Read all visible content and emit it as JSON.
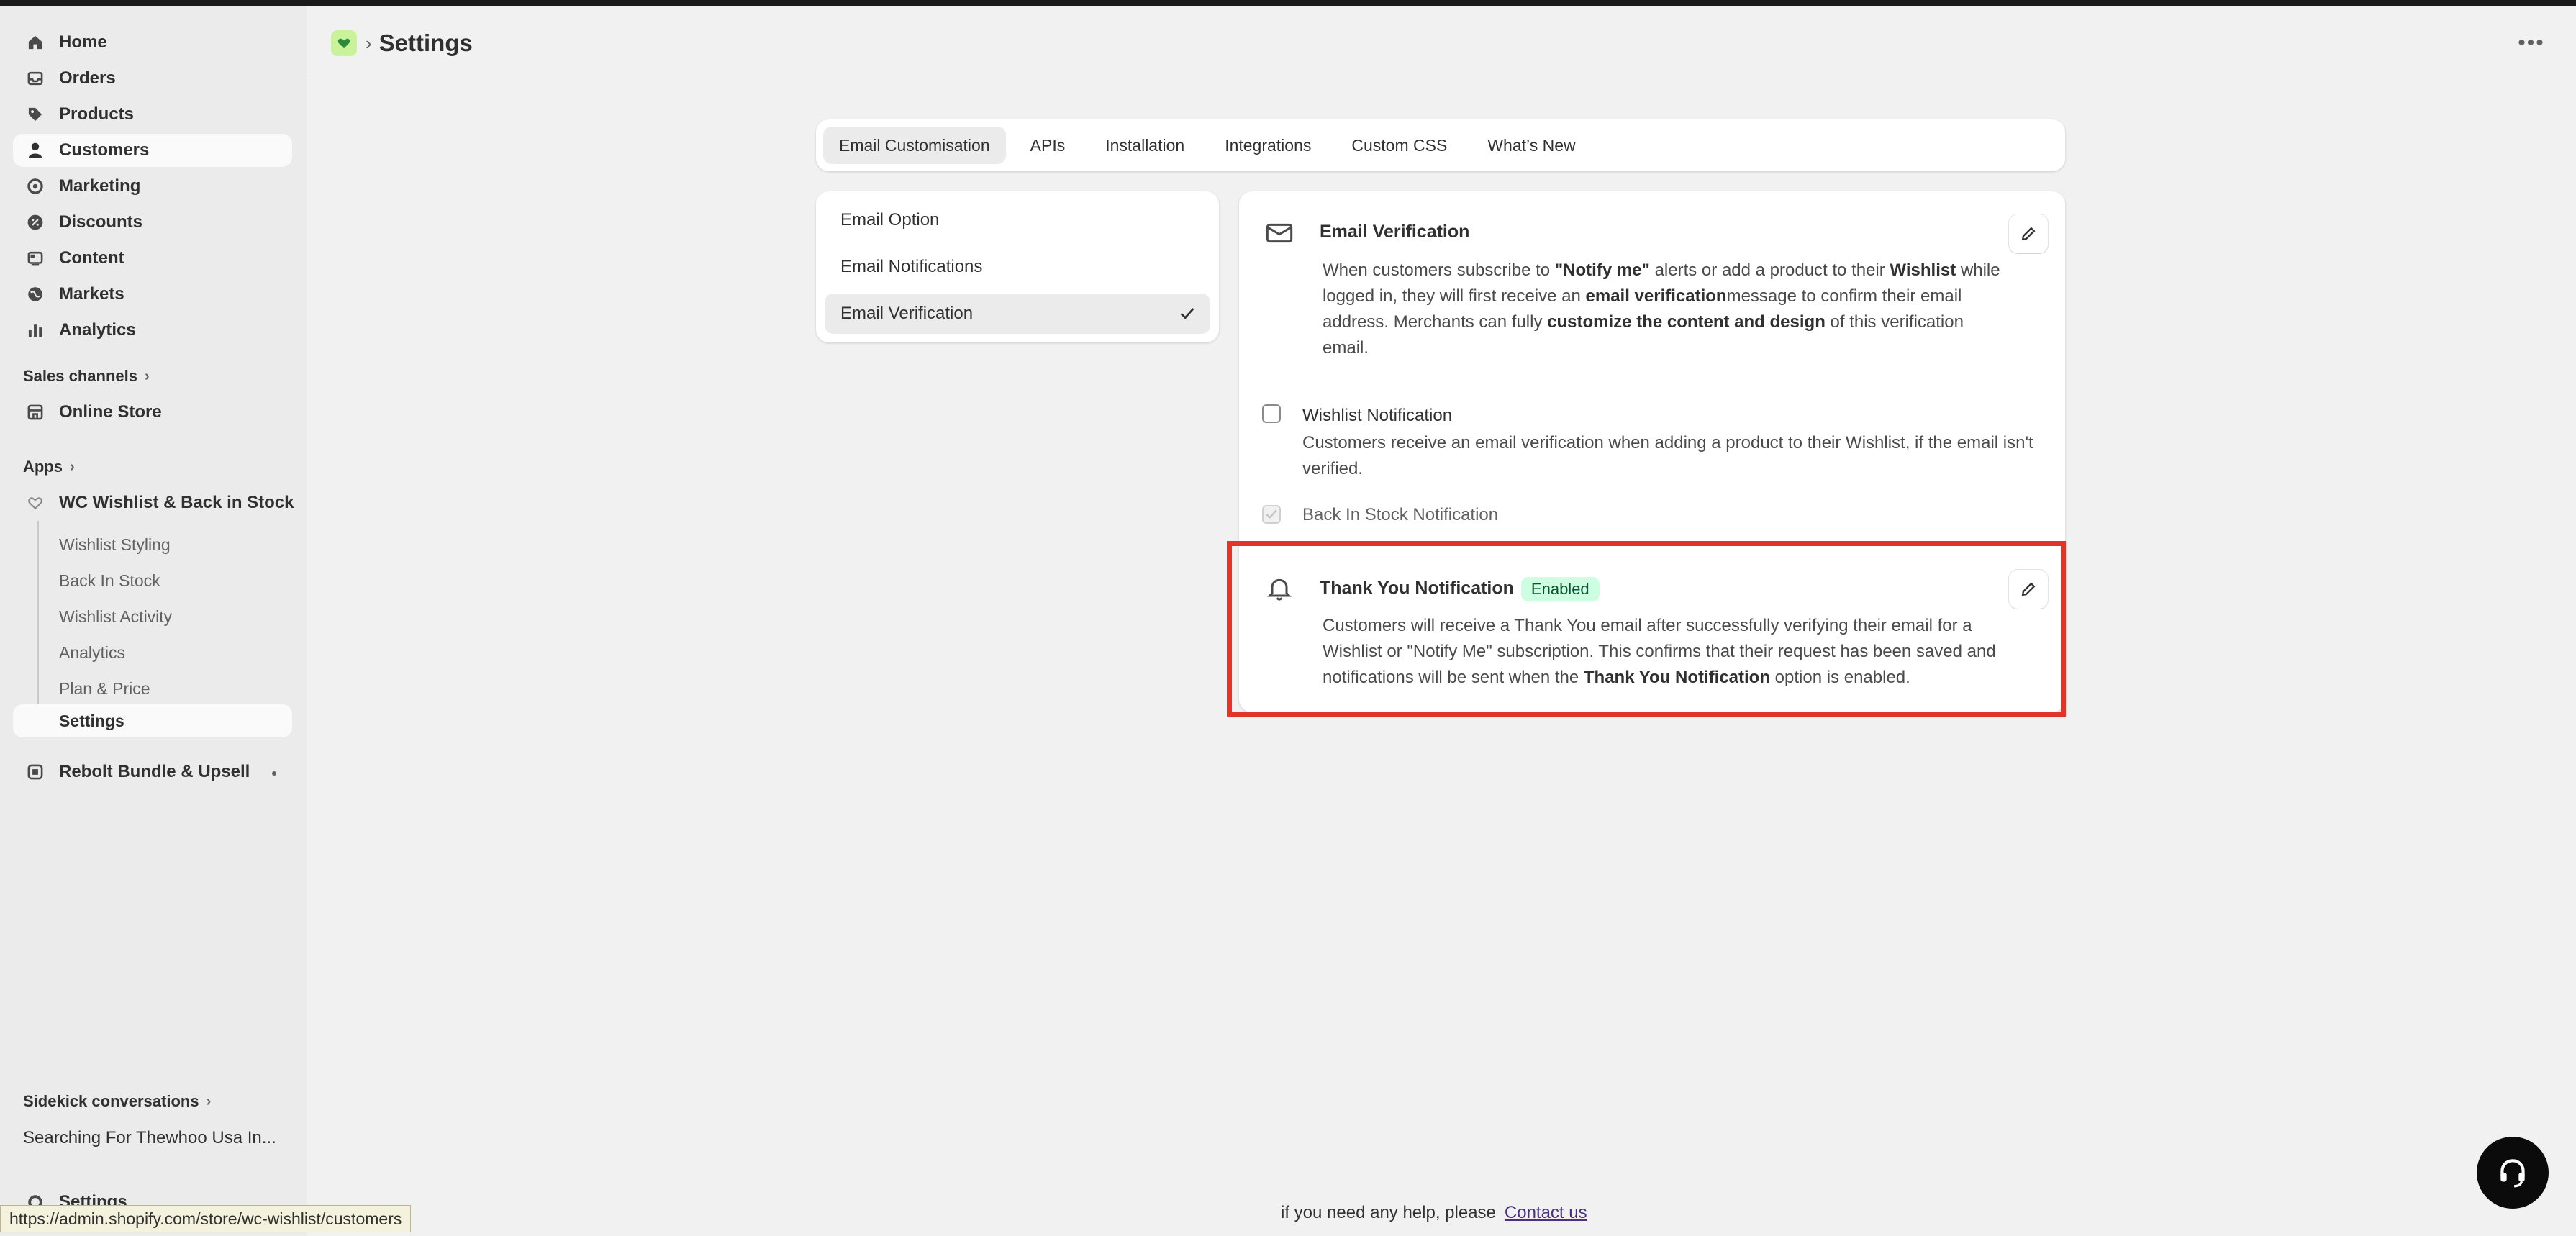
{
  "sidebar": {
    "main_items": [
      {
        "label": "Home",
        "icon": "home-icon"
      },
      {
        "label": "Orders",
        "icon": "orders-icon"
      },
      {
        "label": "Products",
        "icon": "tag-icon"
      },
      {
        "label": "Customers",
        "icon": "person-icon"
      },
      {
        "label": "Marketing",
        "icon": "target-icon"
      },
      {
        "label": "Discounts",
        "icon": "discount-icon"
      },
      {
        "label": "Content",
        "icon": "content-icon"
      },
      {
        "label": "Markets",
        "icon": "globe-icon"
      },
      {
        "label": "Analytics",
        "icon": "bar-chart-icon"
      }
    ],
    "sales_channels_label": "Sales channels",
    "online_store_label": "Online Store",
    "apps_label": "Apps",
    "app_name": "WC Wishlist & Back in Stock",
    "app_sub_items": [
      "Wishlist Styling",
      "Back In Stock",
      "Wishlist Activity",
      "Analytics",
      "Plan & Price",
      "Settings"
    ],
    "rebolt_label": "Rebolt Bundle & Upsell",
    "sidekick_label": "Sidekick conversations",
    "sidekick_item": "Searching For Thewhoo Usa In...",
    "bottom_settings": "Settings",
    "status_url": "https://admin.shopify.com/store/wc-wishlist/customers"
  },
  "header": {
    "title": "Settings"
  },
  "tabs": [
    "Email Customisation",
    "APIs",
    "Installation",
    "Integrations",
    "Custom CSS",
    "What’s New"
  ],
  "side_menu": [
    "Email Option",
    "Email Notifications",
    "Email Verification"
  ],
  "email_verification": {
    "title": "Email Verification",
    "d1": "When customers subscribe to ",
    "b1": "\"Notify me\"",
    "d2": " alerts or add a product to their ",
    "b2": "Wishlist",
    "d3": " while logged in, they will first receive an ",
    "b3": "email verification",
    "d4": "message to confirm their email address. Merchants can fully ",
    "b4": "customize the content and design",
    "d5": " of this verification email."
  },
  "wishlist_notification": {
    "label": "Wishlist Notification",
    "desc": "Customers receive an email verification when adding a product to their Wishlist, if the email isn't verified."
  },
  "back_in_stock_label": "Back In Stock Notification",
  "thank_you": {
    "title": "Thank You Notification",
    "badge": "Enabled",
    "d1": "Customers will receive a Thank You email after successfully verifying their email for a Wishlist or \"Notify Me\" subscription. This confirms that their request has been saved and notifications will be sent when the ",
    "b1": "Thank You Notification",
    "d2": " option is enabled."
  },
  "footer": {
    "text": "if you need any help, please",
    "link": "Contact us"
  },
  "colors": {
    "highlight": "#e0362a",
    "badge_bg": "#cdfee1",
    "sidebar_bg": "#ebebeb"
  }
}
